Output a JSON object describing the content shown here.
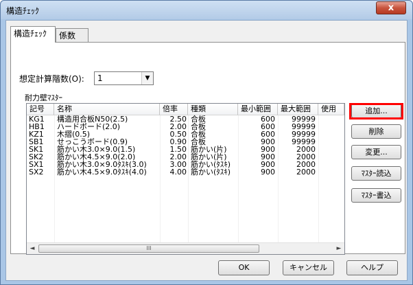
{
  "window": {
    "title": "構造ﾁｪｯｸ",
    "close_label": "x"
  },
  "tabs": [
    {
      "label": "構造ﾁｪｯｸ"
    },
    {
      "label": "係数"
    }
  ],
  "floors": {
    "label": "想定計算階数(O):",
    "value": "1"
  },
  "list": {
    "caption": "耐力壁ﾏｽﾀｰ",
    "columns": [
      "記号",
      "名称",
      "倍率",
      "種類",
      "最小範囲",
      "最大範囲",
      "使用"
    ],
    "rows": [
      [
        "KG1",
        "構造用合板N50(2.5)",
        "2.50",
        "合板",
        "600",
        "99999",
        ""
      ],
      [
        "HB1",
        "ハードボード(2.0)",
        "2.00",
        "合板",
        "600",
        "99999",
        ""
      ],
      [
        "KZ1",
        "木摺(0.5)",
        "0.50",
        "合板",
        "600",
        "99999",
        ""
      ],
      [
        "SB1",
        "せっこうボード(0.9)",
        "0.90",
        "合板",
        "900",
        "99999",
        ""
      ],
      [
        "SK1",
        "筋かい木3.0×9.0(1.5)",
        "1.50",
        "筋かい(片)",
        "900",
        "2000",
        ""
      ],
      [
        "SK2",
        "筋かい木4.5×9.0(2.0)",
        "2.00",
        "筋かい(片)",
        "900",
        "2000",
        ""
      ],
      [
        "SX1",
        "筋かい木3.0×9.0ﾀｽｷ(3.0)",
        "3.00",
        "筋かい(ﾀｽｷ)",
        "900",
        "2000",
        ""
      ],
      [
        "SX2",
        "筋かい木4.5×9.0ﾀｽｷ(4.0)",
        "4.00",
        "筋かい(ﾀｽｷ)",
        "900",
        "2000",
        ""
      ]
    ],
    "scroll_thumb": "III"
  },
  "side_buttons": {
    "add": "追加...",
    "delete": "削除",
    "change": "変更...",
    "load": "ﾏｽﾀｰ読込",
    "save": "ﾏｽﾀｰ書込"
  },
  "footer": {
    "ok": "OK",
    "cancel": "キャンセル",
    "help": "ヘルプ"
  },
  "colors": {
    "highlight": "#ff0000",
    "title_bar": "#b3cbe7"
  }
}
